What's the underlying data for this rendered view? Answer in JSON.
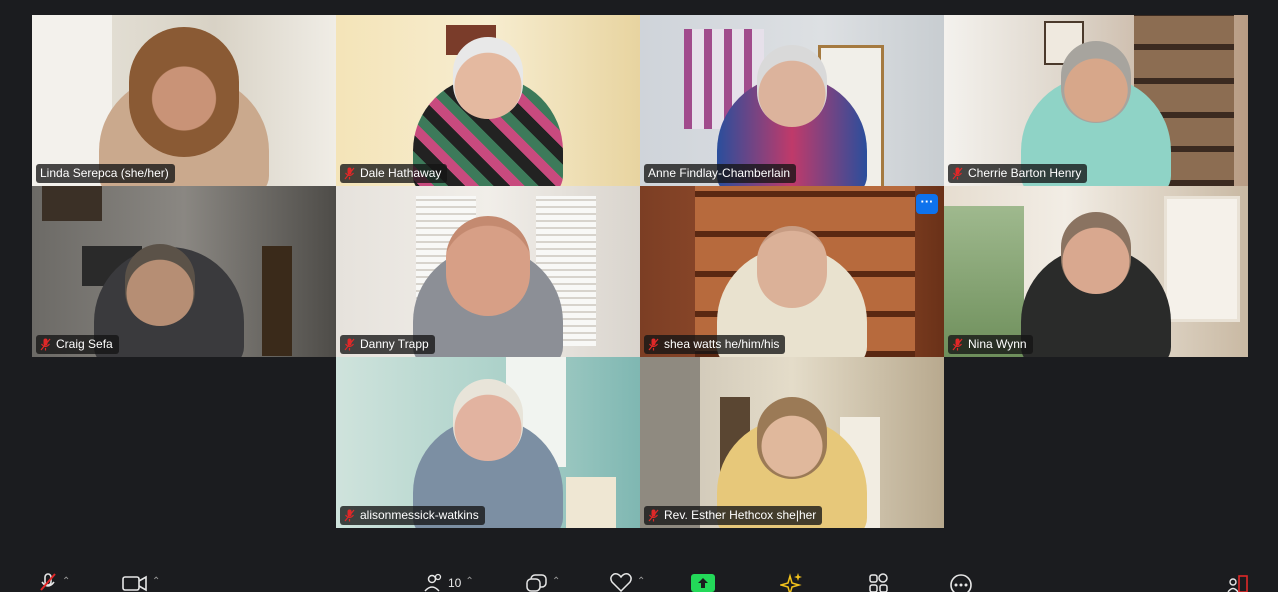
{
  "participants": [
    {
      "name": "Linda Serepca (she/her)",
      "muted": false
    },
    {
      "name": "Dale Hathaway",
      "muted": true
    },
    {
      "name": "Anne Findlay-Chamberlain",
      "muted": false
    },
    {
      "name": "Cherrie Barton Henry",
      "muted": true
    },
    {
      "name": "Craig Sefa",
      "muted": true
    },
    {
      "name": "Danny Trapp",
      "muted": true
    },
    {
      "name": "shea watts he/him/his",
      "muted": true
    },
    {
      "name": "Nina Wynn",
      "muted": true
    },
    {
      "name": "alisonmessick-watkins",
      "muted": true
    },
    {
      "name": "Rev. Esther Hethcox she|her",
      "muted": true
    }
  ],
  "active_speaker": "Linda Serepca (she/her)",
  "more_button_label": "···",
  "toolbar": {
    "participants_count": "10",
    "icons": [
      "microphone-muted-icon",
      "video-camera-icon",
      "participants-icon",
      "chat-icon",
      "reactions-icon",
      "share-screen-icon",
      "ai-companion-icon",
      "apps-icon",
      "more-icon",
      "leave-icon"
    ]
  },
  "colors": {
    "background": "#1b1c1f",
    "active_border": "#23d959",
    "mute_red": "#e02828",
    "share_green": "#23d959",
    "accent_blue": "#0e72ed"
  }
}
